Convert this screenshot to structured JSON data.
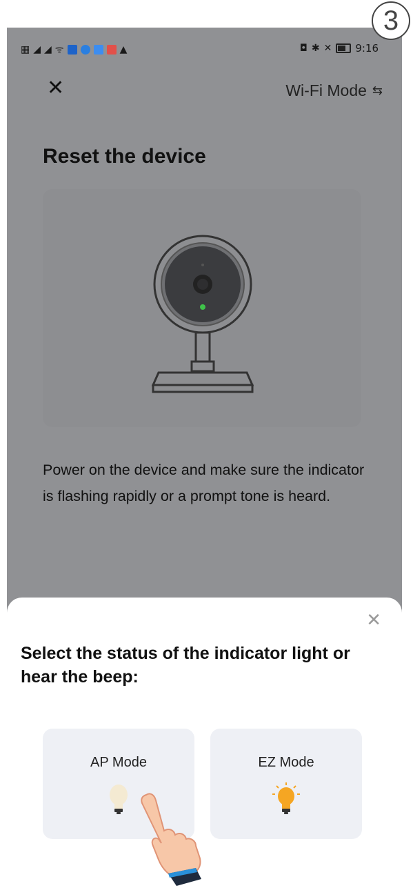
{
  "step": "3",
  "status_bar": {
    "time": "9:16"
  },
  "header": {
    "close_icon": "close-icon",
    "mode_label": "Wi-Fi Mode",
    "mode_icon": "swap-icon"
  },
  "page": {
    "title": "Reset the device",
    "description": "Power on the device and make sure the indicator is flashing rapidly or a prompt tone is heard."
  },
  "colors": {
    "background_dimmed": "#909194",
    "sheet": "#ffffff",
    "card": "#eef0f5",
    "indicator_green": "#3fc24a",
    "bulb_on": "#f5a623"
  },
  "sheet": {
    "title": "Select the status of the indicator light or hear the beep:",
    "close_icon": "close-icon",
    "options": [
      {
        "label": "AP Mode",
        "icon": "bulb-dim-icon"
      },
      {
        "label": "EZ Mode",
        "icon": "bulb-lit-icon"
      }
    ]
  }
}
